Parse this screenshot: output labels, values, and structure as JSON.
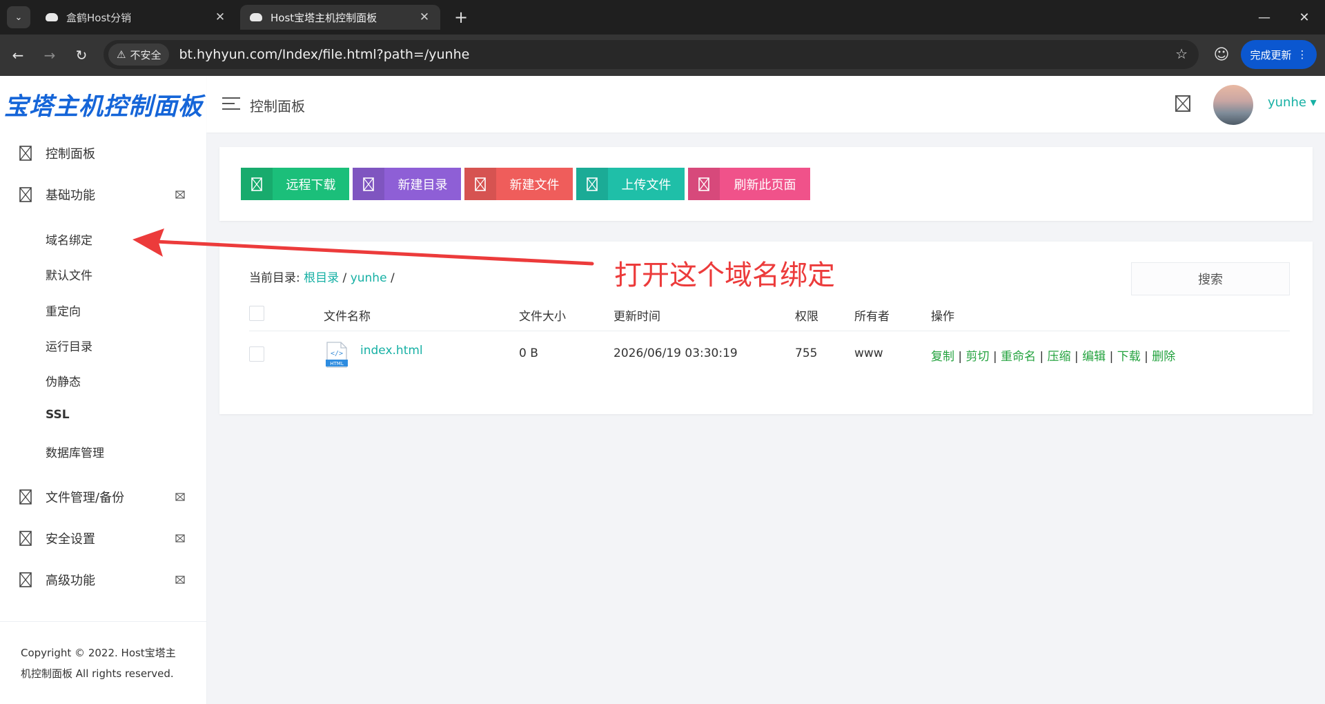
{
  "browser": {
    "tabs": [
      {
        "title": "盒鹤Host分销",
        "active": false
      },
      {
        "title": "Host宝塔主机控制面板",
        "active": true
      }
    ],
    "security_label": "不安全",
    "url": "bt.hyhyun.com/Index/file.html?path=/yunhe",
    "update_label": "完成更新"
  },
  "header": {
    "logo_text": "宝塔主机控制面板",
    "page_title": "控制面板",
    "user_name": "yunhe ▾"
  },
  "sidebar": {
    "items": [
      {
        "label": "控制面板"
      },
      {
        "label": "基础功能"
      },
      {
        "label": "文件管理/备份"
      },
      {
        "label": "安全设置"
      },
      {
        "label": "高级功能"
      }
    ],
    "sub_items": [
      {
        "label": "域名绑定"
      },
      {
        "label": "默认文件"
      },
      {
        "label": "重定向"
      },
      {
        "label": "运行目录"
      },
      {
        "label": "伪静态"
      },
      {
        "label": "SSL"
      },
      {
        "label": "数据库管理"
      }
    ],
    "copyright_line1": "Copyright © 2022. Host宝塔主",
    "copyright_line2": "机控制面板 All rights reserved."
  },
  "actions": [
    {
      "label": "远程下载",
      "color": "#1bbf7a"
    },
    {
      "label": "新建目录",
      "color": "#8e5fd6"
    },
    {
      "label": "新建文件",
      "color": "#ef5d5b"
    },
    {
      "label": "上传文件",
      "color": "#1fbfa8"
    },
    {
      "label": "刷新此页面",
      "color": "#f0528a"
    }
  ],
  "file_manager": {
    "breadcrumb_label": "当前目录:",
    "breadcrumb_root": "根目录",
    "breadcrumb_sep1": "/",
    "breadcrumb_dir": "yunhe",
    "breadcrumb_sep2": "/",
    "search_label": "搜索",
    "columns": [
      "文件名称",
      "文件大小",
      "更新时间",
      "权限",
      "所有者",
      "操作"
    ],
    "rows": [
      {
        "name": "index.html",
        "size": "0 B",
        "updated": "2026/06/19 03:30:19",
        "perm": "755",
        "owner": "www",
        "ops": [
          "复制",
          "剪切",
          "重命名",
          "压缩",
          "编辑",
          "下载",
          "删除"
        ]
      }
    ],
    "file_icon_text": "HTML"
  },
  "annotation": {
    "text": "打开这个域名绑定",
    "color": "#ec3b3b"
  }
}
